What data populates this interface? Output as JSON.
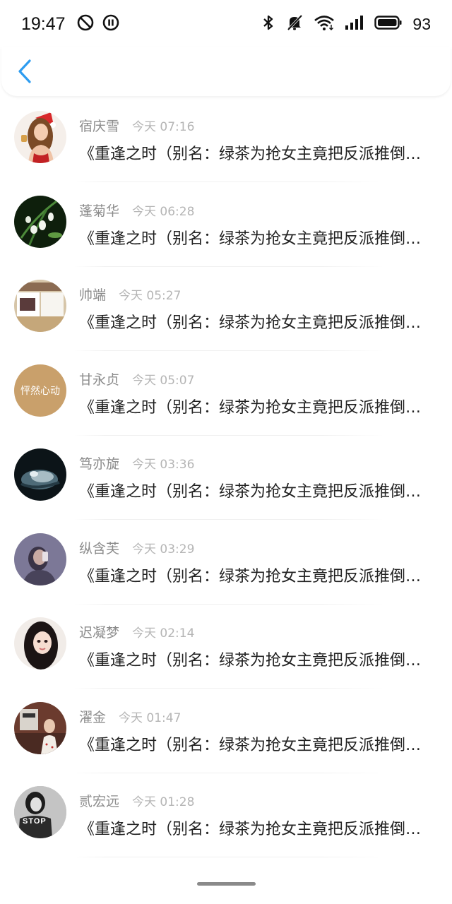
{
  "status_bar": {
    "time": "19:47",
    "battery": "93",
    "icons": [
      "alarm-off-icon",
      "pause-circle-icon",
      "bluetooth-icon",
      "mute-icon",
      "wifi-icon",
      "signal-icon",
      "battery-icon"
    ]
  },
  "header": {
    "back_icon": "chevron-left-icon",
    "accent_color": "#2d9cf0"
  },
  "messages": [
    {
      "name": "宿庆雪",
      "time": "今天 07:16",
      "text": "《重逢之时（别名：绿茶为抢女主竟把反派推倒了）》",
      "avatar": "avatar-1"
    },
    {
      "name": "蓬菊华",
      "time": "今天 06:28",
      "text": "《重逢之时（别名：绿茶为抢女主竟把反派推倒了）》",
      "avatar": "avatar-2"
    },
    {
      "name": "帅端",
      "time": "今天 05:27",
      "text": "《重逢之时（别名：绿茶为抢女主竟把反派推倒了）》",
      "avatar": "avatar-3"
    },
    {
      "name": "甘永贞",
      "time": "今天 05:07",
      "text": "《重逢之时（别名：绿茶为抢女主竟把反派推倒了）》",
      "avatar": "avatar-4"
    },
    {
      "name": "笃亦旋",
      "time": "今天 03:36",
      "text": "《重逢之时（别名：绿茶为抢女主竟把反派推倒了）》",
      "avatar": "avatar-5"
    },
    {
      "name": "纵含芙",
      "time": "今天 03:29",
      "text": "《重逢之时（别名：绿茶为抢女主竟把反派推倒了）》",
      "avatar": "avatar-6"
    },
    {
      "name": "迟凝梦",
      "time": "今天 02:14",
      "text": "《重逢之时（别名：绿茶为抢女主竟把反派推倒了）》",
      "avatar": "avatar-7"
    },
    {
      "name": "濯金",
      "time": "今天 01:47",
      "text": "《重逢之时（别名：绿茶为抢女主竟把反派推倒了）》",
      "avatar": "avatar-8"
    },
    {
      "name": "贰宏远",
      "time": "今天 01:28",
      "text": "《重逢之时（别名：绿茶为抢女主竟把反派推倒了）》",
      "avatar": "avatar-9"
    }
  ],
  "avatar_text": {
    "avatar_4": "怦然心动",
    "avatar_9": "STOP"
  }
}
